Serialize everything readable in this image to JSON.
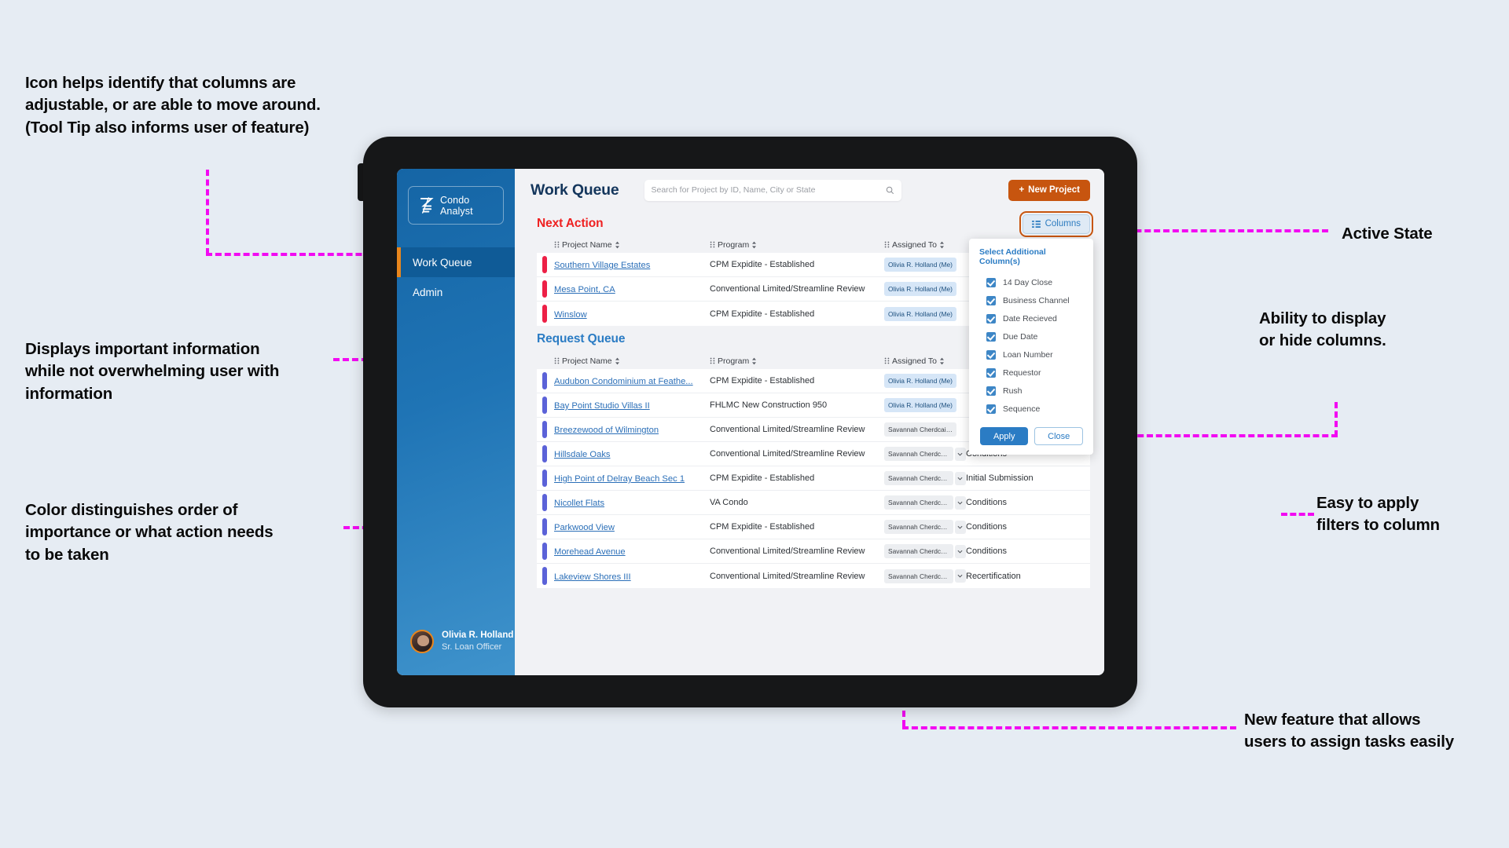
{
  "annotations": [
    {
      "id": "a",
      "text": "Icon helps identify that columns are\nadjustable, or are able to move around.\n(Tool Tip also informs user of feature)"
    },
    {
      "id": "b",
      "text": "Displays important information\nwhile not overwhelming user with\ninformation"
    },
    {
      "id": "c",
      "text": "Color distinguishes order of\nimportance or what action needs\nto be taken"
    },
    {
      "id": "d",
      "text": "Active State"
    },
    {
      "id": "e",
      "text": "Ability to display\nor hide columns."
    },
    {
      "id": "f",
      "text": "Easy to apply\nfilters to column"
    },
    {
      "id": "g",
      "text": "New feature that allows\nusers to assign tasks easily"
    }
  ],
  "app": {
    "logo_text": "Condo Analyst",
    "page_title": "Work Queue",
    "sidebar": {
      "items": [
        {
          "label": "Work Queue",
          "active": true
        },
        {
          "label": "Admin",
          "active": false
        }
      ],
      "profile": {
        "name": "Olivia R. Holland",
        "role": "Sr. Loan Officer"
      }
    },
    "search": {
      "placeholder": "Search for Project by ID, Name, City or State",
      "value": ""
    },
    "new_project_label": "New Project",
    "columns_button_label": "Columns",
    "sections": [
      {
        "id": "next-action",
        "title": "Next Action",
        "accent": "#ef2121",
        "bar_color": "#ed2046",
        "headers": [
          "Project Name",
          "Program",
          "Assigned To",
          ""
        ],
        "rows": [
          {
            "project": "Southern Village Estates",
            "program": "CPM Expidite - Established",
            "assigned": "Olivia R. Holland (Me)",
            "assigned_style": "blue",
            "status": ""
          },
          {
            "project": "Mesa Point, CA",
            "program": "Conventional Limited/Streamline Review",
            "assigned": "Olivia R. Holland (Me)",
            "assigned_style": "blue",
            "status": ""
          },
          {
            "project": "Winslow",
            "program": "CPM Expidite - Established",
            "assigned": "Olivia R. Holland (Me)",
            "assigned_style": "blue",
            "status": ""
          }
        ]
      },
      {
        "id": "request-queue",
        "title": "Request Queue",
        "accent": "#2b7cc4",
        "bar_color": "#5b62d8",
        "headers": [
          "Project Name",
          "Program",
          "Assigned To",
          ""
        ],
        "rows": [
          {
            "project": "Audubon Condominium at Feathe...",
            "program": "CPM Expidite - Established",
            "assigned": "Olivia R. Holland (Me)",
            "assigned_style": "blue",
            "status": ""
          },
          {
            "project": "Bay Point Studio Villas II",
            "program": "FHLMC New Construction 950",
            "assigned": "Olivia R. Holland (Me)",
            "assigned_style": "blue",
            "status": ""
          },
          {
            "project": "Breezewood of Wilmington",
            "program": "Conventional Limited/Streamline Review",
            "assigned": "Savannah Cherdcaitha...",
            "assigned_style": "grey",
            "status": ""
          },
          {
            "project": "Hillsdale Oaks",
            "program": "Conventional Limited/Streamline Review",
            "assigned": "Savannah Cherdcaitha...",
            "assigned_style": "grey",
            "status": "Conditions"
          },
          {
            "project": "High Point of Delray Beach Sec 1",
            "program": "CPM Expidite - Established",
            "assigned": "Savannah Cherdcaitha...",
            "assigned_style": "grey",
            "status": "Initial Submission"
          },
          {
            "project": "Nicollet Flats",
            "program": "VA Condo",
            "assigned": "Savannah Cherdcaitha...",
            "assigned_style": "grey",
            "status": "Conditions"
          },
          {
            "project": "Parkwood View",
            "program": "CPM Expidite - Established",
            "assigned": "Savannah Cherdcaitha...",
            "assigned_style": "grey",
            "status": "Conditions"
          },
          {
            "project": "Morehead Avenue",
            "program": "Conventional Limited/Streamline Review",
            "assigned": "Savannah Cherdcaitha...",
            "assigned_style": "grey",
            "status": "Conditions"
          },
          {
            "project": "Lakeview Shores III",
            "program": "Conventional Limited/Streamline Review",
            "assigned": "Savannah Cherdcaitha...",
            "assigned_style": "grey",
            "status": "Recertification"
          }
        ]
      }
    ],
    "columns_panel": {
      "title": "Select Additional Column(s)",
      "options": [
        {
          "label": "14 Day Close",
          "checked": true
        },
        {
          "label": "Business Channel",
          "checked": true
        },
        {
          "label": "Date Recieved",
          "checked": true
        },
        {
          "label": "Due Date",
          "checked": true
        },
        {
          "label": "Loan Number",
          "checked": true
        },
        {
          "label": "Requestor",
          "checked": true
        },
        {
          "label": "Rush",
          "checked": true
        },
        {
          "label": "Sequence",
          "checked": true
        }
      ],
      "apply_label": "Apply",
      "close_label": "Close"
    }
  },
  "colors": {
    "page_bg": "#e6ecf3",
    "annotation_line": "#f20af2",
    "brand_orange": "#c7550f",
    "brand_blue": "#2b7cc4",
    "sidebar_blue": "#1f74b5",
    "next_action_red": "#ef2121",
    "rail_red": "#ed2046",
    "rail_blue": "#5b62d8"
  }
}
